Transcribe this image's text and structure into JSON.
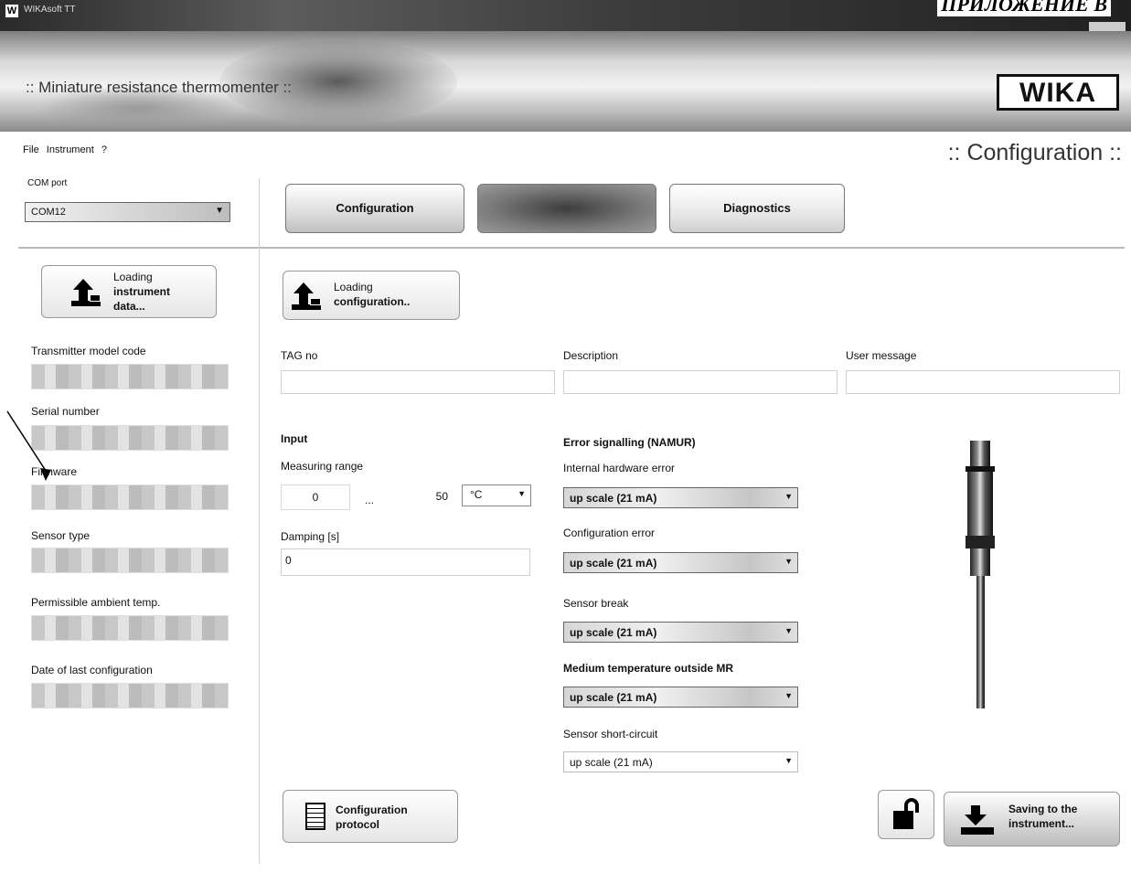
{
  "window": {
    "title": "WIKAsoft TT"
  },
  "page_corner_text": "ПРИЛОЖЕНИЕ В",
  "banner": {
    "title": ":: Miniature resistance thermomenter ::",
    "logo_text": "WIKA"
  },
  "menu": {
    "items": [
      "File",
      "Instrument",
      "?"
    ]
  },
  "section_title": ":: Configuration ::",
  "com_port": {
    "label": "COM port",
    "value": "COM12"
  },
  "tabs": {
    "configuration": "Configuration",
    "measurement": "",
    "diagnostics": "Diagnostics"
  },
  "buttons": {
    "load_instrument": [
      "Loading",
      "instrument",
      "data..."
    ],
    "load_configuration": [
      "Loading",
      "configuration.."
    ],
    "configuration_protocol": [
      "Configuration",
      "protocol"
    ],
    "save_instrument": [
      "Saving to the",
      "instrument..."
    ]
  },
  "left_panel": {
    "fields": [
      {
        "label": "Transmitter model code"
      },
      {
        "label": "Serial number"
      },
      {
        "label": "Firmware"
      },
      {
        "label": "Sensor type"
      },
      {
        "label": "Permissible ambient temp."
      },
      {
        "label": "Date of last configuration"
      }
    ]
  },
  "main": {
    "tag_label": "TAG no",
    "description_label": "Description",
    "user_message_label": "User message",
    "input": {
      "title": "Input",
      "range_label": "Measuring range",
      "range_min": "0",
      "range_sep": "...",
      "range_max": "50",
      "unit": "°C",
      "damping_label": "Damping [s]",
      "damping_value": "0"
    },
    "error_signalling": {
      "title": "Error signalling (NAMUR)",
      "items": [
        {
          "label": "Internal hardware error",
          "value": "up scale (21 mA)"
        },
        {
          "label": "Configuration error",
          "value": "up scale (21 mA)"
        },
        {
          "label": "Sensor break",
          "value": "up scale (21 mA)"
        },
        {
          "label": "Medium temperature outside MR",
          "value": "up scale (21 mA)"
        },
        {
          "label": "Sensor short-circuit",
          "value": "up scale (21 mA)"
        }
      ]
    }
  }
}
